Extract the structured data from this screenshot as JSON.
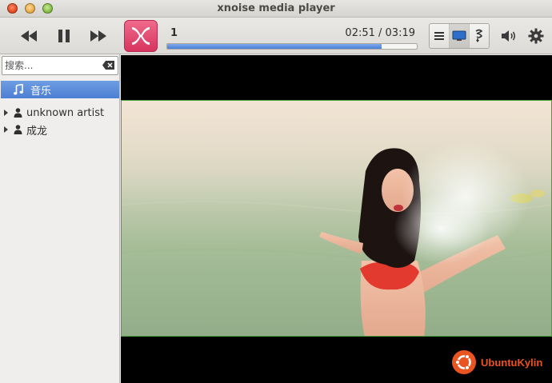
{
  "window": {
    "title": "xnoise media player"
  },
  "toolbar": {
    "previous": "previous-icon",
    "pause": "pause-icon",
    "next": "next-icon",
    "track_number": "1",
    "time": "02:51 / 03:19",
    "progress": 0.86,
    "views": [
      "list-icon",
      "video-icon",
      "lyrics-icon"
    ],
    "active_view": 1
  },
  "sidebar": {
    "search": {
      "placeholder": "搜索...",
      "value": ""
    },
    "library": {
      "label": "音乐",
      "icon": "music-note-icon"
    },
    "artists": [
      {
        "label": "unknown artist"
      },
      {
        "label": "成龙"
      }
    ]
  },
  "video": {
    "watermark": "UbuntuKylin"
  },
  "colors": {
    "accent": "#4c7fd4",
    "logo": "#e04a70",
    "watermark": "#e95420"
  }
}
